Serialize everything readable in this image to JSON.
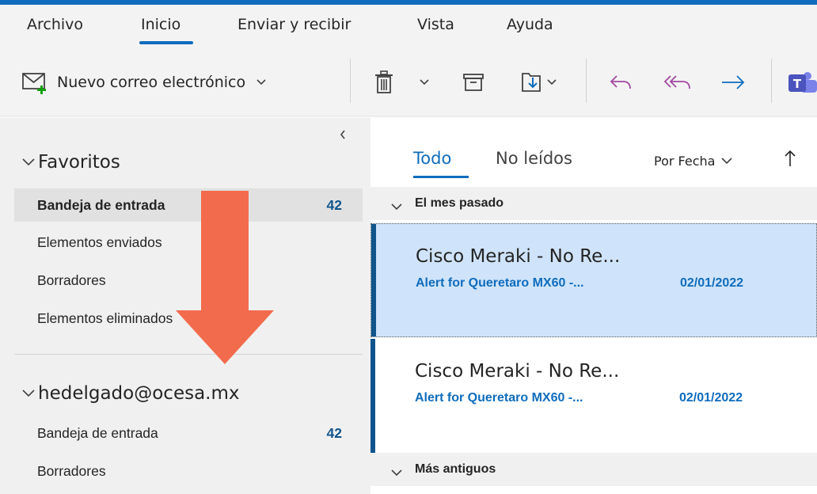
{
  "menu": {
    "items": [
      {
        "label": "Archivo"
      },
      {
        "label": "Inicio"
      },
      {
        "label": "Enviar y recibir"
      },
      {
        "label": "Vista"
      },
      {
        "label": "Ayuda"
      }
    ],
    "active": "Inicio"
  },
  "ribbon": {
    "new_mail_label": "Nuevo correo electrónico"
  },
  "folders": {
    "favorites": {
      "header": "Favoritos",
      "items": [
        {
          "label": "Bandeja de entrada",
          "count": "42"
        },
        {
          "label": "Elementos enviados"
        },
        {
          "label": "Borradores"
        },
        {
          "label": "Elementos eliminados"
        }
      ]
    },
    "account": {
      "header": "hedelgado@ocesa.mx",
      "items": [
        {
          "label": "Bandeja de entrada",
          "count": "42"
        },
        {
          "label": "Borradores"
        }
      ]
    }
  },
  "message_list": {
    "filters": [
      {
        "label": "Todo"
      },
      {
        "label": "No leídos"
      }
    ],
    "sort_label": "Por Fecha",
    "groups": [
      {
        "label": "El mes pasado"
      },
      {
        "label": "Más antiguos"
      }
    ],
    "messages": [
      {
        "sender": "Cisco Meraki - No Re...",
        "subject": "Alert for Queretaro MX60 -...",
        "date": "02/01/2022"
      },
      {
        "sender": "Cisco Meraki - No Re...",
        "subject": "Alert for Queretaro MX60 -...",
        "date": "02/01/2022"
      }
    ]
  },
  "colors": {
    "accent": "#0f6cbd",
    "annotation_arrow": "#f26b4c",
    "selected_message": "#cfe4fa"
  }
}
